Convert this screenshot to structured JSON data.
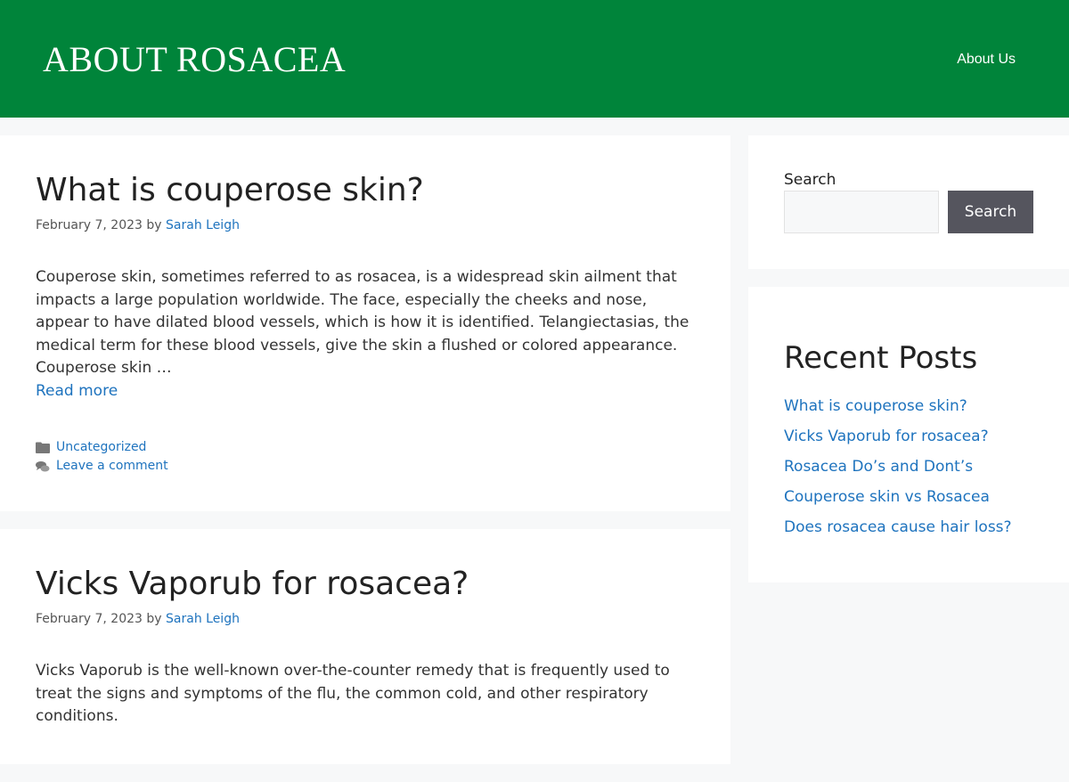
{
  "header": {
    "logo": "ABOUT ROSACEA",
    "nav": [
      {
        "label": "About Us"
      }
    ]
  },
  "posts": [
    {
      "title": "What is couperose skin?",
      "date": "February 7, 2023",
      "by": "by",
      "author": "Sarah Leigh",
      "excerpt": "Couperose skin, sometimes referred to as rosacea, is a widespread skin ailment that impacts a large population worldwide. The face, especially the cheeks and nose, appear to have dilated blood vessels, which is how it is identified. Telangiectasias, the medical term for these blood vessels, give the skin a flushed or colored appearance. Couperose skin …",
      "read_more": "Read more",
      "category": "Uncategorized",
      "comment": "Leave a comment"
    },
    {
      "title": "Vicks Vaporub for rosacea?",
      "date": "February 7, 2023",
      "by": "by",
      "author": "Sarah Leigh",
      "excerpt": "Vicks Vaporub is the well-known over-the-counter remedy that is frequently used to treat the signs and symptoms of the flu, the common cold, and other respiratory conditions."
    }
  ],
  "sidebar": {
    "search_label": "Search",
    "search_button": "Search",
    "recent_title": "Recent Posts",
    "recent_posts": [
      "What is couperose skin?",
      "Vicks Vaporub for rosacea?",
      "Rosacea Do’s and Dont’s",
      "Couperose skin vs Rosacea",
      "Does rosacea cause hair loss?"
    ]
  },
  "icons": {
    "category": "folder-icon",
    "comment": "comments-icon"
  },
  "colors": {
    "header_bg": "#00843a",
    "link": "#1e73be",
    "button_bg": "#55555e"
  }
}
